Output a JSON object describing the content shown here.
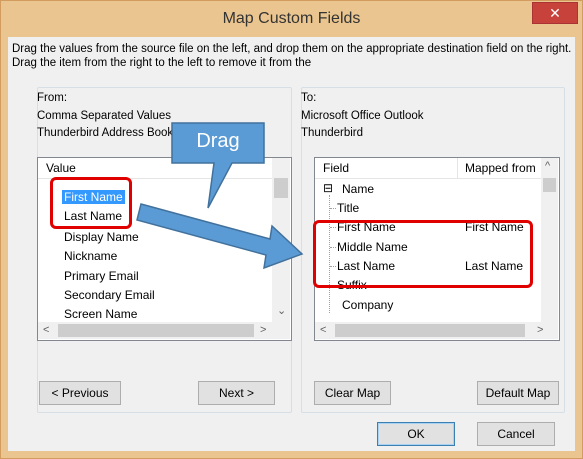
{
  "window": {
    "title": "Map Custom Fields",
    "close_label": "✕"
  },
  "instructions": "Drag the values from the source file on the left, and drop them on the appropriate destination field on the right.  Drag the item from the right to the left to remove it from the",
  "from": {
    "label": "From:",
    "line1": "Comma Separated Values",
    "line2": "Thunderbird Address Book",
    "column_header": "Value",
    "items": [
      "First Name",
      "Last Name",
      "Display Name",
      "Nickname",
      "Primary Email",
      "Secondary Email",
      "Screen Name"
    ],
    "previous_label": "< Previous",
    "next_label": "Next >"
  },
  "to": {
    "label": "To:",
    "line1": "Microsoft Office Outlook",
    "line2": "Thunderbird",
    "column_field": "Field",
    "column_mapped": "Mapped from",
    "root": "Name",
    "rows": [
      {
        "field": "Title",
        "mapped": ""
      },
      {
        "field": "First Name",
        "mapped": "First Name"
      },
      {
        "field": "Middle Name",
        "mapped": ""
      },
      {
        "field": "Last Name",
        "mapped": "Last Name"
      },
      {
        "field": "Suffix",
        "mapped": ""
      },
      {
        "field": "Company",
        "mapped": ""
      }
    ],
    "clear_map_label": "Clear Map",
    "default_map_label": "Default Map"
  },
  "buttons": {
    "ok": "OK",
    "cancel": "Cancel"
  },
  "annotation": {
    "callout_text": "Drag"
  },
  "colors": {
    "title_bar": "#ebc58f",
    "close_button": "#c7423a",
    "selection": "#3399ff",
    "highlight_box": "#e00000",
    "callout": "#5b9bd5"
  }
}
